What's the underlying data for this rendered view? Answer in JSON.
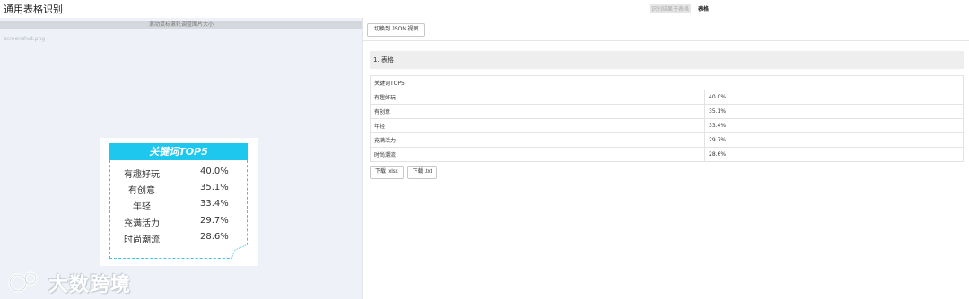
{
  "header": {
    "title": "通用表格识别",
    "tabs": [
      {
        "label": "识别结果于表格",
        "active": false
      },
      {
        "label": "表格",
        "active": true
      }
    ]
  },
  "left_pane": {
    "zoom_hint": "滚动鼠标滚轮调整图片大小",
    "file_name": "screenshot.png",
    "card": {
      "title": "关键词TOP5",
      "rows": [
        {
          "name": "有趣好玩",
          "value": "40.0%"
        },
        {
          "name": "有创意",
          "value": "35.1%"
        },
        {
          "name": "年轻",
          "value": "33.4%"
        },
        {
          "name": "充满活力",
          "value": "29.7%"
        },
        {
          "name": "时尚潮流",
          "value": "28.6%"
        }
      ]
    },
    "watermark": "大数跨境"
  },
  "right_pane": {
    "json_button": "切换到 JSON 视图",
    "section_title": "1. 表格",
    "table": {
      "header": "关键词TOP5",
      "rows": [
        [
          "有趣好玩",
          "40.0%"
        ],
        [
          "有创意",
          "35.1%"
        ],
        [
          "年轻",
          "33.4%"
        ],
        [
          "充满活力",
          "29.7%"
        ],
        [
          "时尚潮流",
          "28.6%"
        ]
      ]
    },
    "downloads": {
      "xlsx": "下载 .xlsx",
      "txt": "下载 .txt"
    }
  },
  "colors": {
    "card_accent": "#1ec7ee",
    "left_bg": "#eef1f8"
  }
}
